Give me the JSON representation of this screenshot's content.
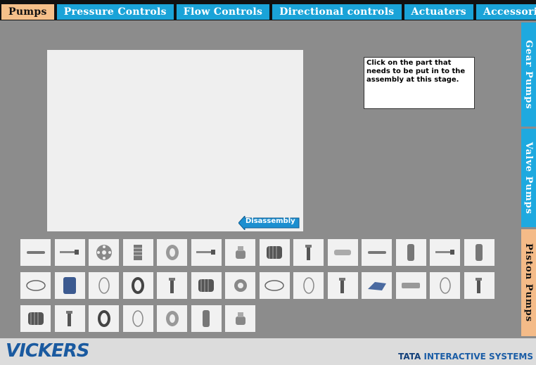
{
  "tabs": [
    {
      "label": "Pumps",
      "active": true
    },
    {
      "label": "Pressure Controls",
      "active": false
    },
    {
      "label": "Flow Controls",
      "active": false
    },
    {
      "label": "Directional controls",
      "active": false
    },
    {
      "label": "Actuaters",
      "active": false
    },
    {
      "label": "Accessories",
      "active": false
    }
  ],
  "side_tabs": {
    "gear": "Gear Pumps",
    "valve": "Valve Pumps",
    "piston": "Piston Pumps"
  },
  "instruction": "Click on the part that needs to be put in to the assembly at this stage.",
  "disassembly_label": "Disassembly",
  "parts": [
    "rod",
    "screw",
    "ring-plate",
    "spring-block",
    "washer",
    "screw",
    "cap",
    "bearing",
    "pin",
    "sleeve",
    "rod",
    "cylinder",
    "screw",
    "cylinder",
    "gasket",
    "block",
    "o-ring",
    "ring",
    "pin",
    "bearing",
    "ring-cap",
    "gasket",
    "o-ring",
    "pin",
    "plate",
    "bar",
    "o-ring",
    "pin",
    "bearing",
    "pin",
    "ring",
    "o-ring",
    "washer",
    "cylinder",
    "cap"
  ],
  "footer": {
    "logo": "VICKERS",
    "company_brand": "TATA",
    "company_rest": "INTERACTIVE SYSTEMS"
  },
  "colors": {
    "tab_blue": "#1aa3d8",
    "tab_active": "#f5c08a",
    "background": "#8c8c8c"
  }
}
